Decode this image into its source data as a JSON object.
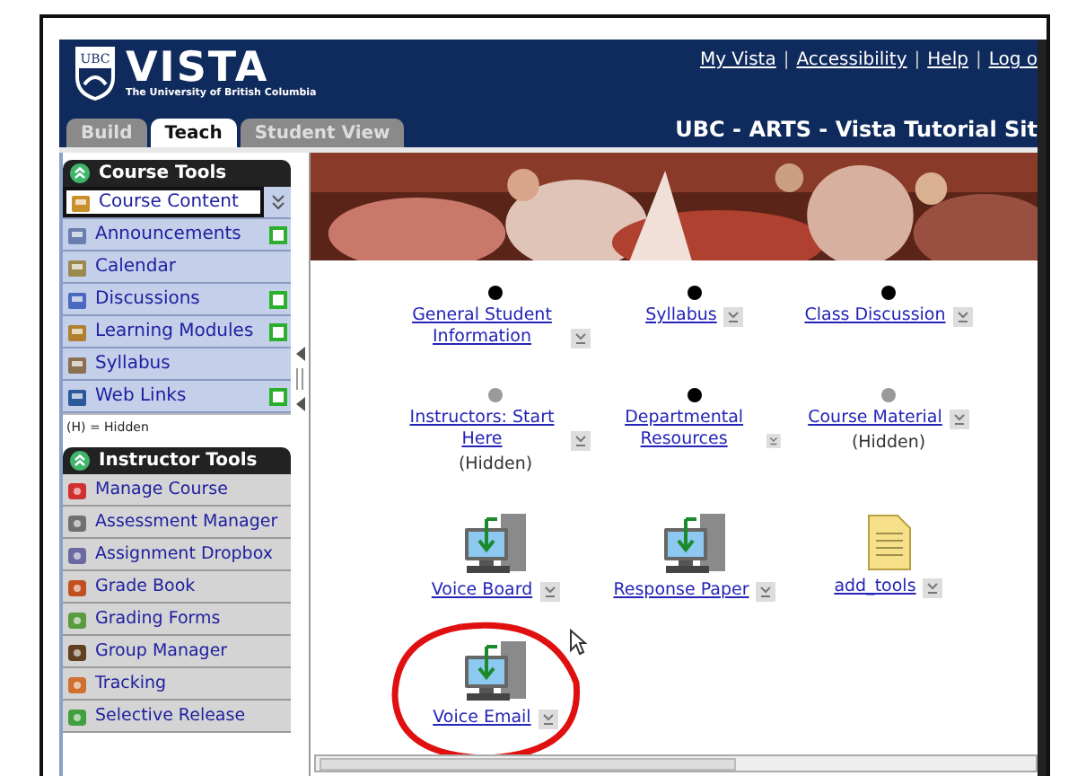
{
  "header": {
    "brand": "VISTA",
    "subtitle": "The University of British Columbia",
    "logo_text": "UBC",
    "links": [
      "My Vista",
      "Accessibility",
      "Help",
      "Log o"
    ],
    "link_separator": "|",
    "site_title": "UBC - ARTS - Vista Tutorial Sit"
  },
  "tabs": [
    {
      "label": "Build",
      "selected": false
    },
    {
      "label": "Teach",
      "selected": true
    },
    {
      "label": "Student View",
      "selected": false
    }
  ],
  "course_tools": {
    "title": "Course Tools",
    "items": [
      {
        "label": "Course Content",
        "selected": true,
        "new": false
      },
      {
        "label": "Announcements",
        "selected": false,
        "new": true
      },
      {
        "label": "Calendar",
        "selected": false,
        "new": false
      },
      {
        "label": "Discussions",
        "selected": false,
        "new": true
      },
      {
        "label": "Learning Modules",
        "selected": false,
        "new": true
      },
      {
        "label": "Syllabus",
        "selected": false,
        "new": false
      },
      {
        "label": "Web Links",
        "selected": false,
        "new": true
      }
    ],
    "legend": "(H) = Hidden"
  },
  "instructor_tools": {
    "title": "Instructor Tools",
    "items": [
      {
        "label": "Manage Course"
      },
      {
        "label": "Assessment Manager"
      },
      {
        "label": "Assignment Dropbox"
      },
      {
        "label": "Grade Book"
      },
      {
        "label": "Grading Forms"
      },
      {
        "label": "Group Manager"
      },
      {
        "label": "Tracking"
      },
      {
        "label": "Selective Release"
      }
    ]
  },
  "content": {
    "items": [
      {
        "kind": "bullet",
        "label": "General Student Information",
        "hidden": false
      },
      {
        "kind": "bullet",
        "label": "Syllabus",
        "hidden": false
      },
      {
        "kind": "bullet",
        "label": "Class Discussion",
        "hidden": false
      },
      {
        "kind": "bullet",
        "label": "Instructors: Start Here",
        "hidden": true,
        "note": "(Hidden)"
      },
      {
        "kind": "bullet",
        "label": "Departmental Resources",
        "hidden": false
      },
      {
        "kind": "bullet",
        "label": "Course Material",
        "hidden": true,
        "note": "(Hidden)"
      },
      {
        "kind": "computer",
        "label": "Voice Board"
      },
      {
        "kind": "computer",
        "label": "Response Paper"
      },
      {
        "kind": "document",
        "label": "add_tools"
      },
      {
        "kind": "computer",
        "label": "Voice Email",
        "circled": true
      }
    ]
  }
}
